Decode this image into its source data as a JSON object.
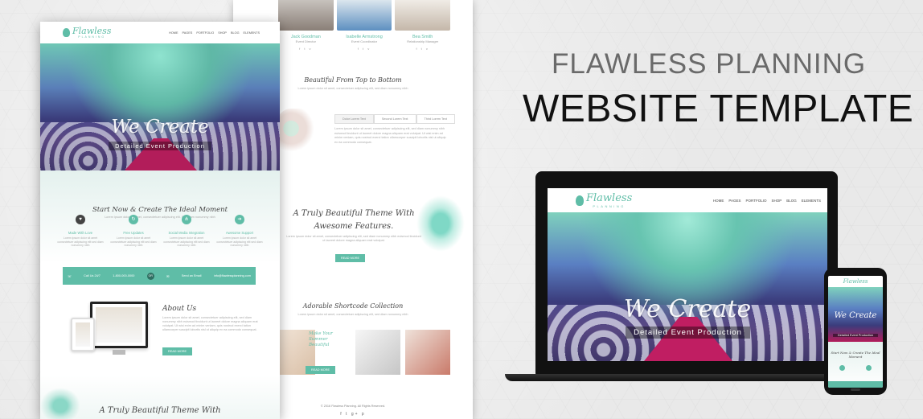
{
  "heading": {
    "line1": "FLAWLESS PLANNING",
    "line2": "WEBSITE TEMPLATE"
  },
  "brand": {
    "name": "Flawless",
    "tagline": "PLANNING",
    "accent": "#5fbda7"
  },
  "nav": [
    "HOME",
    "PAGES",
    "PORTFOLIO",
    "SHOP",
    "BLOG",
    "ELEMENTS"
  ],
  "hero": {
    "title": "We Create",
    "subtitle": "Detailed Event Production"
  },
  "front": {
    "start_title": "Start Now & Create The Ideal Moment",
    "start_sub": "Lorem ipsum dolor sit amet, consectetuer adipiscing elit. Sed diam nonummy nibh",
    "features": [
      {
        "title": "Made With Love",
        "text": "Lorem ipsum dolor sit amet consectetuer adipiscing elit sed diam nonummy nibh"
      },
      {
        "title": "Free Updates",
        "text": "Lorem ipsum dolor sit amet consectetuer adipiscing elit sed diam nonummy nibh"
      },
      {
        "title": "Social Media Integration",
        "text": "Lorem ipsum dolor sit amet consectetuer adipiscing elit sed diam nonummy nibh"
      },
      {
        "title": "Awesome Support",
        "text": "Lorem ipsum dolor sit amet consectetuer adipiscing elit sed diam nonummy nibh"
      }
    ],
    "contact": {
      "call": "Call Us 24/7",
      "phone": "1-800-000-0000",
      "or": "OR",
      "email_label": "Send an Email",
      "email": "info@flawlessplanning.com"
    },
    "about_title": "About Us",
    "about_text": "Lorem ipsum dolor sit amet, consectetuer adipiscing elit, sed diam nonummy nibh euismod tincidunt ut laoreet dolore magna aliquam erat volutpat. Ut wisi enim ad minim veniam, quis nostrud exerci tation ullamcorper suscipit lobortis nisl ut aliquip ex ea commodo consequat.",
    "read_more": "READ MORE",
    "bottom_title": "A Truly Beautiful Theme With"
  },
  "back": {
    "team": [
      {
        "name": "Jack Goodman",
        "role": "Event Director"
      },
      {
        "name": "Isabelle Armstrong",
        "role": "Event Coordinator"
      },
      {
        "name": "Bea Smith",
        "role": "Relationship Manager"
      }
    ],
    "team_social": "f  t  v",
    "beautiful_title": "Beautiful From Top to Bottom",
    "beautiful_sub": "Lorem ipsum dolor sit amet, consectetuer adipiscing elit, sed diam nonummy nibh",
    "tabs": [
      "Dolor Lorem Text",
      "Second Lorem Text",
      "Third Lorem Text"
    ],
    "tab_text": "Lorem ipsum dolor sit amet, consectetuer adipiscing elit, sed diam nonummy nibh euismod tincidunt ut laoreet dolore magna aliquam erat volutpat. Ut wisi enim ad minim veniam, quis nostrud exerci tation ullamcorper suscipit lobortis nisl ut aliquip ex ea commodo consequat.",
    "features_title": "A Truly Beautiful Theme With Awesome Features.",
    "features_sub": "Lorem ipsum dolor sit amet, consectetuer adipiscing elit, sed diam nonummy nibh euismod tincidunt ut laoreet dolore magna aliquam erat volutpat.",
    "features_btn": "READ MORE",
    "shortcode_title": "Adorable Shortcode Collection",
    "shortcode_sub": "Lorem ipsum dolor sit amet, consectetuer adipiscing elit, sed diam nonummy nibh",
    "make_text": "Make Your Summer Beautiful",
    "make_btn": "READ MORE",
    "footer": "© 2016 Flawless Planning. All Rights Reserved.",
    "footer_icons": "f t g+ p"
  },
  "phone": {
    "start_title": "Start Now & Create The Ideal Moment"
  }
}
